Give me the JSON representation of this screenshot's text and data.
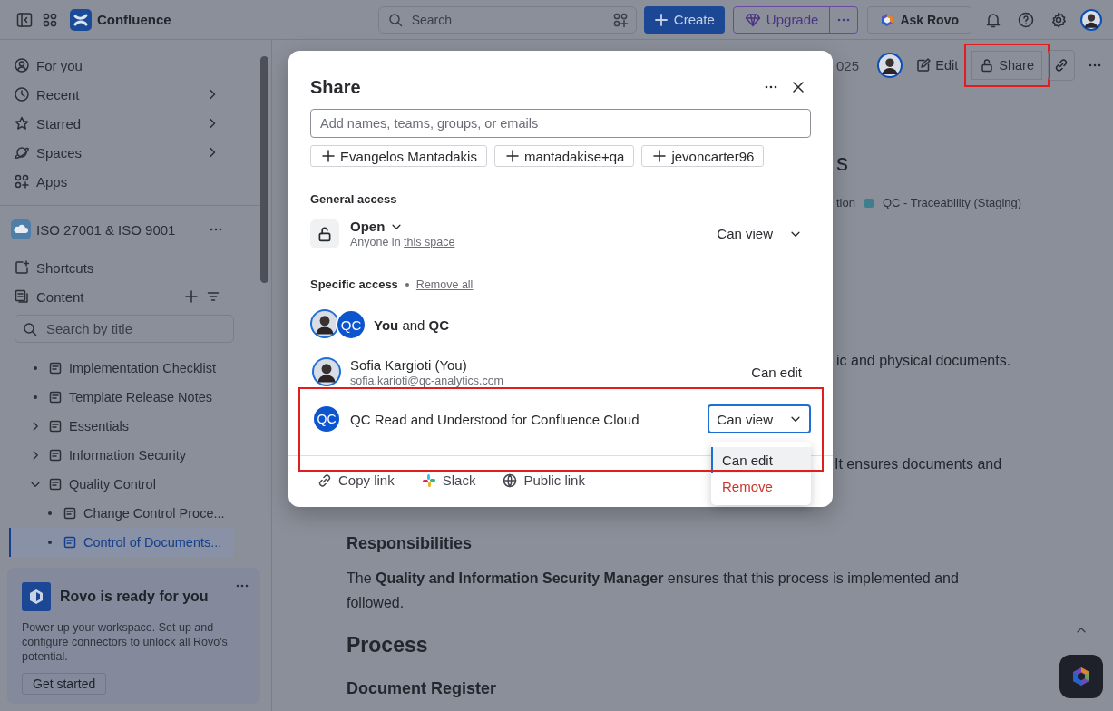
{
  "topbar": {
    "product": "Confluence",
    "search": {
      "placeholder": "Search"
    },
    "create": "Create",
    "upgrade": "Upgrade",
    "ask_rovo": "Ask Rovo"
  },
  "sidebar": {
    "nav": [
      {
        "label": "For you",
        "has_submenu": false
      },
      {
        "label": "Recent",
        "has_submenu": true
      },
      {
        "label": "Starred",
        "has_submenu": true
      },
      {
        "label": "Spaces",
        "has_submenu": true
      },
      {
        "label": "Apps",
        "has_submenu": false
      }
    ],
    "space": {
      "name": "ISO 27001 & ISO 9001"
    },
    "sections": [
      {
        "label": "Shortcuts",
        "actions": false
      },
      {
        "label": "Content",
        "actions": true
      }
    ],
    "search": {
      "placeholder": "Search by title"
    },
    "tree": [
      {
        "label": "Implementation Checklist",
        "kind": "leaf",
        "selected": false
      },
      {
        "label": "Template Release Notes",
        "kind": "leaf",
        "selected": false
      },
      {
        "label": "Essentials",
        "kind": "parent",
        "expanded": false,
        "selected": false
      },
      {
        "label": "Information Security",
        "kind": "parent",
        "expanded": false,
        "selected": false
      },
      {
        "label": "Quality Control",
        "kind": "parent",
        "expanded": true,
        "selected": false,
        "children": [
          {
            "label": "Change Control Proce...",
            "kind": "leaf",
            "selected": false
          },
          {
            "label": "Control of Documents...",
            "kind": "leaf",
            "selected": true
          }
        ]
      }
    ],
    "promo": {
      "title": "Rovo is ready for you",
      "text": "Power up your workspace. Set up and configure connectors to unlock all Rovo's potential.",
      "button": "Get started"
    }
  },
  "page": {
    "byline_date": "025",
    "actions": [
      {
        "label": "Edit",
        "highlighted": false
      },
      {
        "label": "Share",
        "highlighted": true
      }
    ],
    "title_fragment": "s",
    "breadcrumbs": [
      "tion",
      "QC - Traceability (Staging)"
    ],
    "hidden_lines": [
      "ic and physical documents.",
      "It ensures documents and"
    ],
    "body": [
      {
        "kind": "h3",
        "text": "Responsibilities"
      },
      {
        "kind": "p",
        "text": "The **Quality and Information Security Manager** ensures that this process is implemented and followed."
      },
      {
        "kind": "h2",
        "text": "Process"
      },
      {
        "kind": "h3",
        "text": "Document Register"
      }
    ]
  },
  "share_dialog": {
    "title": "Share",
    "input": {
      "placeholder": "Add names, teams, groups, or emails"
    },
    "suggestions": [
      "Evangelos Mantadakis",
      "mantadakise+qa",
      "jevoncarter96"
    ],
    "general_access": {
      "heading": "General access",
      "mode": "Open",
      "description": "Anyone in",
      "link": "this space",
      "permission": "Can view"
    },
    "specific_access": {
      "heading": "Specific access",
      "remove_all": "Remove all",
      "summary": "**You** and **QC**",
      "group_initials": "QC",
      "entries": [
        {
          "kind": "person",
          "name": "Sofia Kargioti (You)",
          "email": "sofia.karioti@qc-analytics.com",
          "permission": "Can edit",
          "menu_open": false,
          "highlighted": false
        },
        {
          "kind": "app",
          "initials": "QC",
          "name": "QC Read and Understood for Confluence Cloud",
          "permission": "Can view",
          "menu_open": true,
          "highlighted": true
        }
      ]
    },
    "footer": [
      {
        "label": "Copy link"
      },
      {
        "label": "Slack"
      },
      {
        "label": "Public link"
      }
    ],
    "menu": [
      {
        "label": "Can edit",
        "kind": "option",
        "selected": true
      },
      {
        "label": "Remove",
        "kind": "danger",
        "selected": false
      }
    ]
  }
}
